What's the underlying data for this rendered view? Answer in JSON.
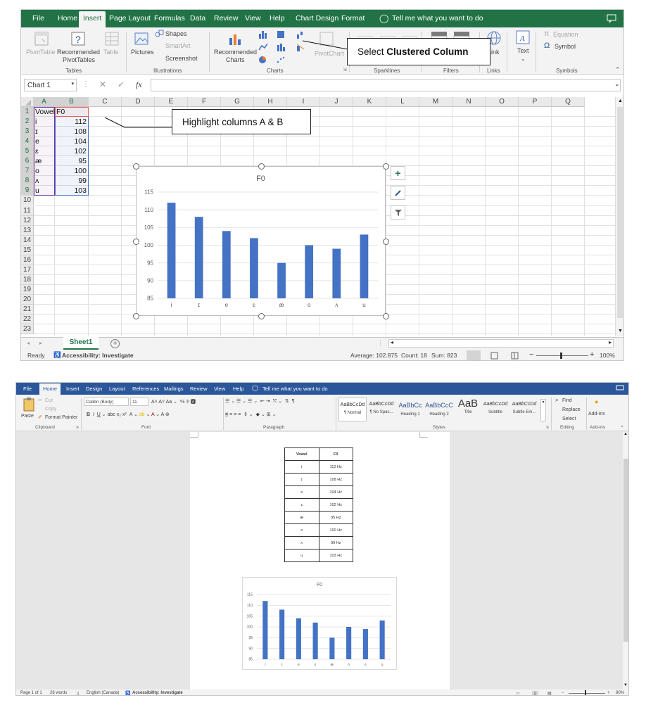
{
  "excel": {
    "tabs": [
      "File",
      "Home",
      "Insert",
      "Page Layout",
      "Formulas",
      "Data",
      "Review",
      "View",
      "Help",
      "Chart Design",
      "Format"
    ],
    "active_tab": "Insert",
    "tell_me": "Tell me what you want to do",
    "ribbon": {
      "pivottable": "PivotTable",
      "recommended_pivot_1": "Recommended",
      "recommended_pivot_2": "PivotTables",
      "table": "Table",
      "pictures": "Pictures",
      "shapes": "Shapes",
      "smartart": "SmartArt",
      "screenshot": "Screenshot",
      "recommended_charts_1": "Recommended",
      "recommended_charts_2": "Charts",
      "pivotchart": "PivotChart",
      "link": "Link",
      "text": "Text",
      "equation": "Equation",
      "symbol": "Symbol",
      "groups": {
        "tables": "Tables",
        "illustrations": "Illustrations",
        "charts": "Charts",
        "sparklines": "Sparklines",
        "filters": "Filters",
        "links": "Links",
        "symbols": "Symbols"
      }
    },
    "callout_chart_prefix": "Select ",
    "callout_chart_bold": "Clustered Column",
    "callout_highlight": "Highlight columns A & B",
    "name_box": "Chart 1",
    "fx": "fx",
    "columns": [
      "A",
      "B",
      "C",
      "D",
      "E",
      "F",
      "G",
      "H",
      "I",
      "J",
      "K",
      "L",
      "M",
      "N",
      "O",
      "P",
      "Q"
    ],
    "rows": [
      "1",
      "2",
      "3",
      "4",
      "5",
      "6",
      "7",
      "8",
      "9",
      "10",
      "11",
      "12",
      "13",
      "14",
      "15",
      "16",
      "17",
      "18",
      "19",
      "20",
      "21",
      "22",
      "23"
    ],
    "cells": [
      {
        "a": "Vowel",
        "b": "F0"
      },
      {
        "a": "i",
        "b": "112"
      },
      {
        "a": "ɪ",
        "b": "108"
      },
      {
        "a": "e",
        "b": "104"
      },
      {
        "a": "ɛ",
        "b": "102"
      },
      {
        "a": "æ",
        "b": "95"
      },
      {
        "a": "o",
        "b": "100"
      },
      {
        "a": "ʌ",
        "b": "99"
      },
      {
        "a": "u",
        "b": "103"
      }
    ],
    "sheet_tab": "Sheet1",
    "status": {
      "ready": "Ready",
      "accessibility": "Accessibility: Investigate",
      "average": "Average: 102.875",
      "count": "Count: 18",
      "sum": "Sum: 823",
      "zoom": "100%"
    }
  },
  "word": {
    "tabs": [
      "File",
      "Home",
      "Insert",
      "Design",
      "Layout",
      "References",
      "Mailings",
      "Review",
      "View",
      "Help"
    ],
    "active_tab": "Home",
    "tell_me": "Tell me what you want to do",
    "ribbon": {
      "paste": "Paste",
      "cut": "Cut",
      "copy": "Copy",
      "format_painter": "Format Painter",
      "font_name": "Calibri (Body)",
      "font_size": "11",
      "styles": [
        {
          "preview": "AaBbCcDd",
          "name": "¶ Normal"
        },
        {
          "preview": "AaBbCcDd",
          "name": "¶ No Spac..."
        },
        {
          "preview": "AaBbCc",
          "name": "Heading 1"
        },
        {
          "preview": "AaBbCcC",
          "name": "Heading 2"
        },
        {
          "preview": "AaB",
          "name": "Title"
        },
        {
          "preview": "AaBbCcDd",
          "name": "Subtitle"
        },
        {
          "preview": "AaBbCcDd",
          "name": "Subtle Em..."
        }
      ],
      "find": "Find",
      "replace": "Replace",
      "select": "Select",
      "addins": "Add-ins",
      "groups": {
        "clipboard": "Clipboard",
        "font": "Font",
        "paragraph": "Paragraph",
        "styles": "Styles",
        "editing": "Editing",
        "addins": "Add-ins"
      }
    },
    "table_header": {
      "vowel": "Vowel",
      "f0": "F0"
    },
    "table_rows": [
      {
        "v": "i",
        "f": "112 Hz"
      },
      {
        "v": "ɪ",
        "f": "108 Hz"
      },
      {
        "v": "e",
        "f": "104 Hz"
      },
      {
        "v": "ɛ",
        "f": "102 Hz"
      },
      {
        "v": "æ",
        "f": "95 Hz"
      },
      {
        "v": "o",
        "f": "100 Hz"
      },
      {
        "v": "ʌ",
        "f": "99 Hz"
      },
      {
        "v": "u",
        "f": "103 Hz"
      }
    ],
    "status": {
      "page": "Page 1 of 1",
      "words": "26 words",
      "language": "English (Canada)",
      "accessibility": "Accessibility: Investigate",
      "zoom": "80%"
    }
  },
  "chart_data": [
    {
      "type": "bar",
      "title": "F0",
      "categories": [
        "i",
        "ɪ",
        "e",
        "ɛ",
        "æ",
        "o",
        "ʌ",
        "u"
      ],
      "values": [
        112,
        108,
        104,
        102,
        95,
        100,
        99,
        103
      ],
      "yticks": [
        "85",
        "90",
        "95",
        "100",
        "105",
        "110",
        "115"
      ],
      "ylim": [
        85,
        115
      ],
      "grid": true,
      "color": "#4472c4"
    },
    {
      "type": "bar",
      "title": "F0",
      "categories": [
        "i",
        "ɪ",
        "e",
        "ɛ",
        "æ",
        "o",
        "ʌ",
        "u"
      ],
      "values": [
        112,
        108,
        104,
        102,
        95,
        100,
        99,
        103
      ],
      "yticks": [
        "85",
        "90",
        "95",
        "100",
        "105",
        "110",
        "115"
      ],
      "ylim": [
        85,
        115
      ],
      "grid": true,
      "color": "#4472c4"
    }
  ]
}
